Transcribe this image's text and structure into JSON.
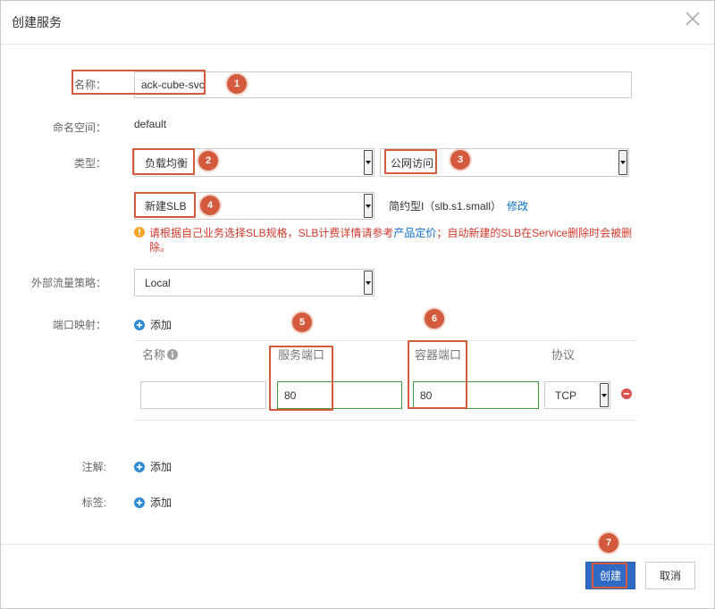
{
  "dialog": {
    "title": "创建服务"
  },
  "form": {
    "name": {
      "label": "名称：",
      "value": "ack-cube-svc"
    },
    "namespace": {
      "label": "命名空间：",
      "value": "default"
    },
    "type": {
      "label": "类型：",
      "service_type": "负载均衡",
      "access_type": "公网访问"
    },
    "slb": {
      "selection": "新建SLB",
      "spec": "简约型I（slb.s1.small）",
      "modify_link": "修改"
    },
    "slb_notice": {
      "text_before": "请根据自己业务选择SLB规格，SLB计费详情请参考",
      "pricing_link": "产品定价",
      "text_after": "；自动新建的SLB在Service删除时会被删除。"
    },
    "traffic_policy": {
      "label": "外部流量策略：",
      "value": "Local"
    },
    "port_mapping": {
      "label": "端口映射：",
      "add_label": "添加",
      "columns": {
        "name": "名称",
        "service_port": "服务端口",
        "container_port": "容器端口",
        "protocol": "协议"
      },
      "rows": [
        {
          "name": "",
          "service_port": "80",
          "container_port": "80",
          "protocol": "TCP"
        }
      ]
    },
    "annotations": {
      "label": "注解:",
      "add_label": "添加"
    },
    "labels": {
      "label": "标签:",
      "add_label": "添加"
    }
  },
  "footer": {
    "create_label": "创建",
    "cancel_label": "取消"
  },
  "step_markers": [
    "1",
    "2",
    "3",
    "4",
    "5",
    "6",
    "7"
  ],
  "icons": {
    "close": "close-icon",
    "dropdown": "chevron-down-icon",
    "notice": "warning-icon",
    "info": "info-icon",
    "add": "plus-circle-icon",
    "remove": "minus-circle-icon"
  },
  "colors": {
    "primary": "#2f6bc4",
    "link": "#0a6fc7",
    "annotation": "#d35a3c",
    "warning_text": "#d0392b",
    "warning_icon": "#f0a429",
    "valid_border": "#3f9a3f",
    "add_icon": "#2d8bd5",
    "remove_icon": "#d9534f"
  }
}
